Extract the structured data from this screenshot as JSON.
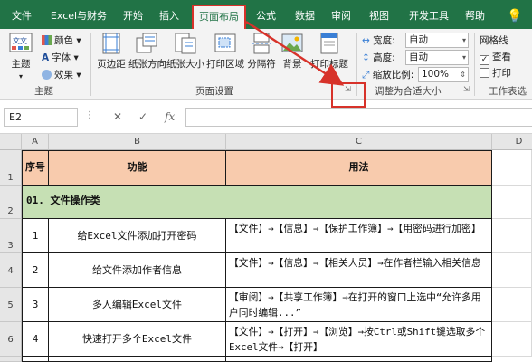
{
  "tabs": [
    "文件",
    "Excel与财务",
    "开始",
    "插入",
    "页面布局",
    "公式",
    "数据",
    "审阅",
    "视图",
    "开发工具",
    "帮助"
  ],
  "active_tab": "页面布局",
  "ribbon": {
    "theme": {
      "label": "主题",
      "colors": "颜色",
      "fonts": "字体",
      "effects": "效果",
      "group": "主题"
    },
    "page_setup": {
      "margins": "页边距",
      "orientation": "纸张方向",
      "size": "纸张大小",
      "print_area": "打印区域",
      "breaks": "分隔符",
      "background": "背景",
      "print_titles": "打印标题",
      "group": "页面设置"
    },
    "scale": {
      "width_label": "宽度:",
      "width_value": "自动",
      "height_label": "高度:",
      "height_value": "自动",
      "scale_label": "缩放比例:",
      "scale_value": "100%",
      "group": "调整为合适大小"
    },
    "sheet_options": {
      "gridlines": "网格线",
      "view": "查看",
      "print": "打印",
      "group": "工作表选"
    }
  },
  "formula_bar": {
    "name_box": "E2",
    "fx": "fx",
    "cancel": "✕",
    "enter": "✓",
    "value": ""
  },
  "columns": [
    "A",
    "B",
    "C",
    "D"
  ],
  "rows": [
    "1",
    "2",
    "3",
    "4",
    "5",
    "6"
  ],
  "table": {
    "headers": [
      "序号",
      "功能",
      "用法"
    ],
    "group_row": "01. 文件操作类",
    "rows": [
      {
        "no": "1",
        "func": "给Excel文件添加打开密码",
        "usage": "【文件】→【信息】→【保护工作簿】→【用密码进行加密】"
      },
      {
        "no": "2",
        "func": "给文件添加作者信息",
        "usage": "【文件】→【信息】→【相关人员】→在作者栏输入相关信息"
      },
      {
        "no": "3",
        "func": "多人编辑Excel文件",
        "usage": "【审阅】→【共享工作簿】→在打开的窗口上选中“允许多用户同时编辑...”"
      },
      {
        "no": "4",
        "func": "快速打开多个Excel文件",
        "usage": "【文件】→【打开】→【浏览】→按Ctrl或Shift键选取多个Excel文件→【打开】"
      }
    ]
  },
  "colors": {
    "ribbon_green": "#217346",
    "header_fill": "#f8cbad",
    "group_fill": "#c6e0b4",
    "annotation_red": "#d7322a"
  }
}
